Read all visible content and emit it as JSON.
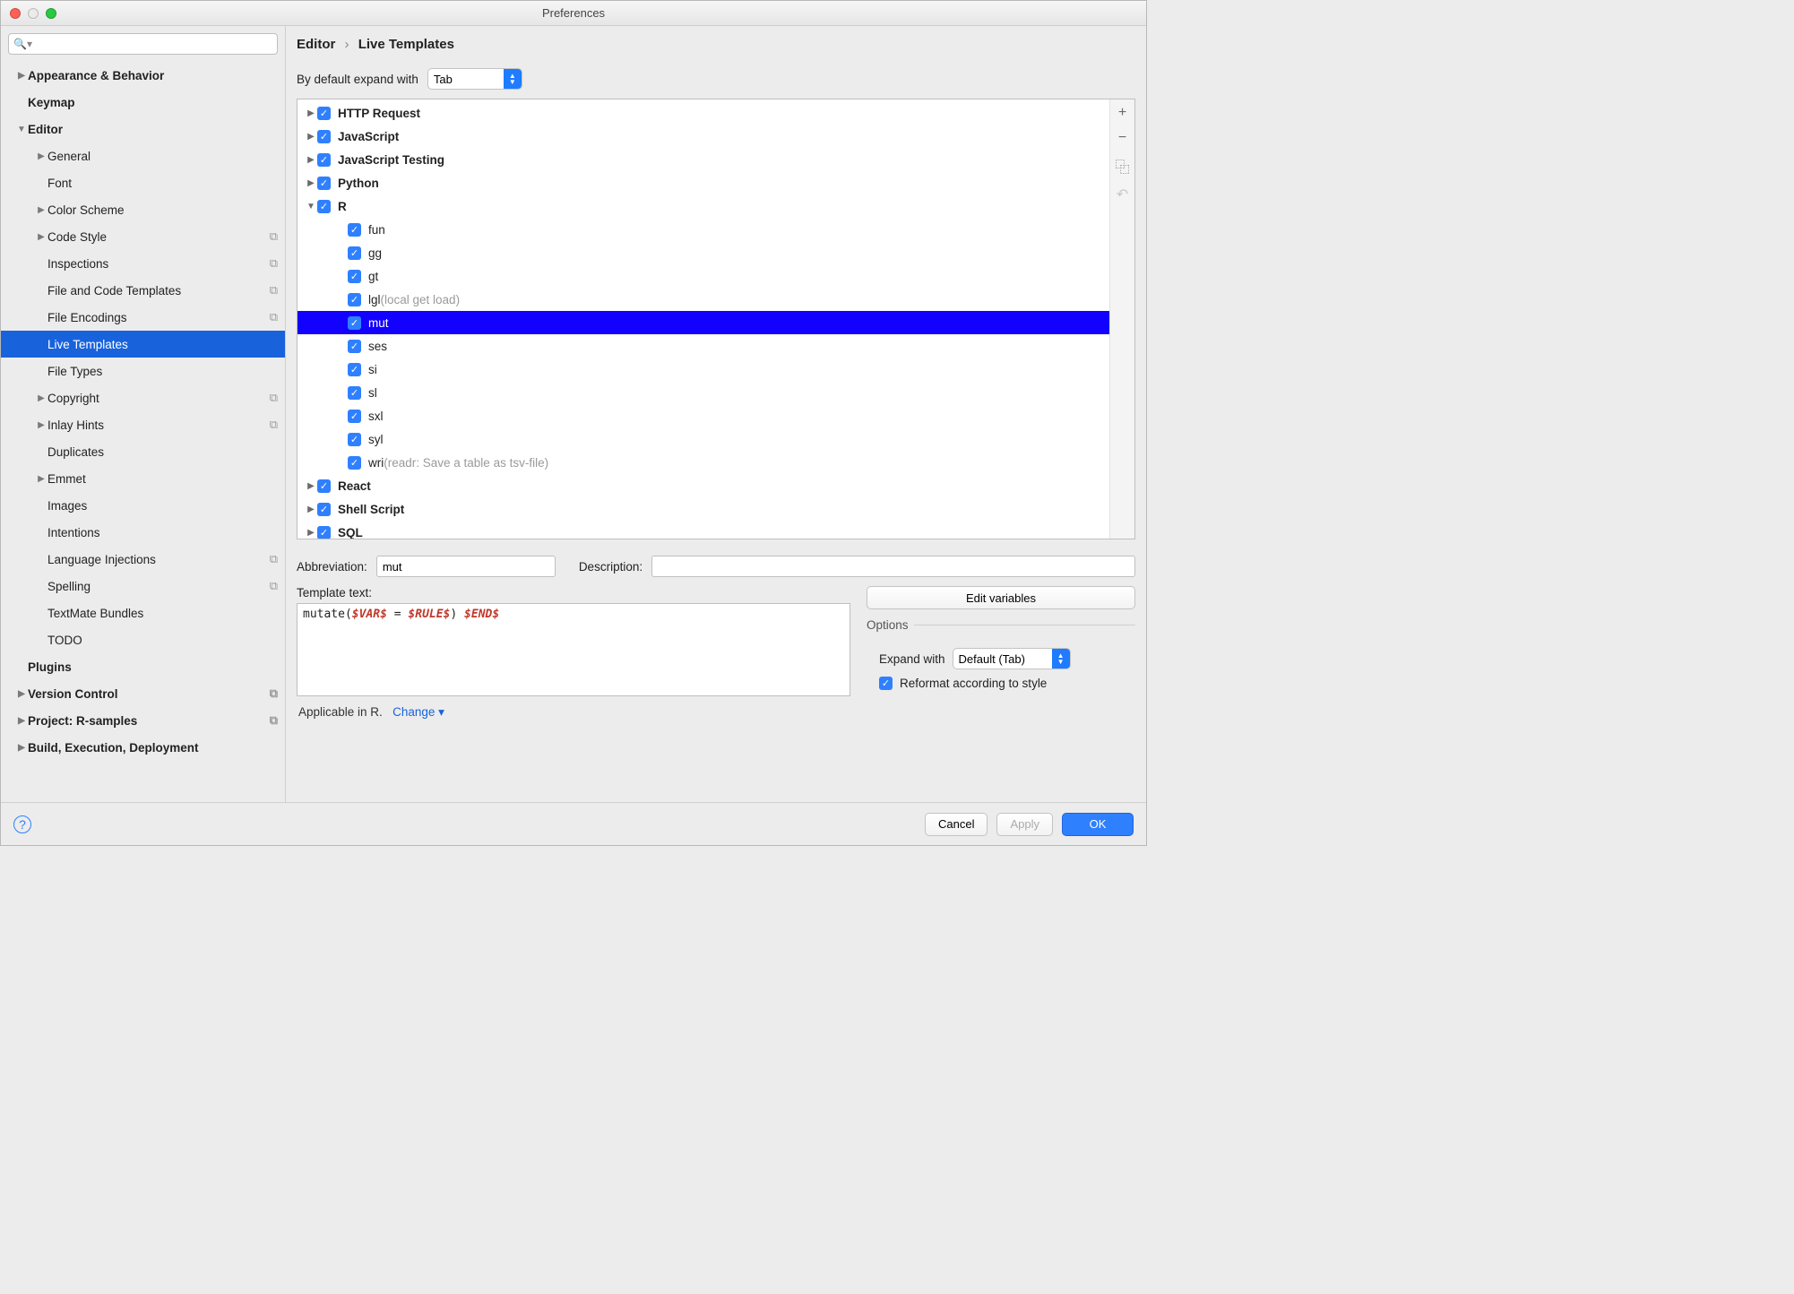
{
  "window_title": "Preferences",
  "search_placeholder": "",
  "breadcrumb": {
    "a": "Editor",
    "b": "Live Templates"
  },
  "expand_label": "By default expand with",
  "expand_value": "Tab",
  "sidebar": [
    {
      "label": "Appearance & Behavior",
      "bold": true,
      "indent": 0,
      "disc": "▶",
      "badge": ""
    },
    {
      "label": "Keymap",
      "bold": true,
      "indent": 0,
      "disc": "",
      "badge": ""
    },
    {
      "label": "Editor",
      "bold": true,
      "indent": 0,
      "disc": "▼",
      "badge": ""
    },
    {
      "label": "General",
      "bold": false,
      "indent": 1,
      "disc": "▶",
      "badge": ""
    },
    {
      "label": "Font",
      "bold": false,
      "indent": 1,
      "disc": "",
      "badge": ""
    },
    {
      "label": "Color Scheme",
      "bold": false,
      "indent": 1,
      "disc": "▶",
      "badge": ""
    },
    {
      "label": "Code Style",
      "bold": false,
      "indent": 1,
      "disc": "▶",
      "badge": "⧉"
    },
    {
      "label": "Inspections",
      "bold": false,
      "indent": 1,
      "disc": "",
      "badge": "⧉"
    },
    {
      "label": "File and Code Templates",
      "bold": false,
      "indent": 1,
      "disc": "",
      "badge": "⧉"
    },
    {
      "label": "File Encodings",
      "bold": false,
      "indent": 1,
      "disc": "",
      "badge": "⧉"
    },
    {
      "label": "Live Templates",
      "bold": false,
      "indent": 1,
      "disc": "",
      "badge": "",
      "selected": true
    },
    {
      "label": "File Types",
      "bold": false,
      "indent": 1,
      "disc": "",
      "badge": ""
    },
    {
      "label": "Copyright",
      "bold": false,
      "indent": 1,
      "disc": "▶",
      "badge": "⧉"
    },
    {
      "label": "Inlay Hints",
      "bold": false,
      "indent": 1,
      "disc": "▶",
      "badge": "⧉"
    },
    {
      "label": "Duplicates",
      "bold": false,
      "indent": 1,
      "disc": "",
      "badge": ""
    },
    {
      "label": "Emmet",
      "bold": false,
      "indent": 1,
      "disc": "▶",
      "badge": ""
    },
    {
      "label": "Images",
      "bold": false,
      "indent": 1,
      "disc": "",
      "badge": ""
    },
    {
      "label": "Intentions",
      "bold": false,
      "indent": 1,
      "disc": "",
      "badge": ""
    },
    {
      "label": "Language Injections",
      "bold": false,
      "indent": 1,
      "disc": "",
      "badge": "⧉"
    },
    {
      "label": "Spelling",
      "bold": false,
      "indent": 1,
      "disc": "",
      "badge": "⧉"
    },
    {
      "label": "TextMate Bundles",
      "bold": false,
      "indent": 1,
      "disc": "",
      "badge": ""
    },
    {
      "label": "TODO",
      "bold": false,
      "indent": 1,
      "disc": "",
      "badge": ""
    },
    {
      "label": "Plugins",
      "bold": true,
      "indent": 0,
      "disc": "",
      "badge": ""
    },
    {
      "label": "Version Control",
      "bold": true,
      "indent": 0,
      "disc": "▶",
      "badge": "⧉"
    },
    {
      "label": "Project: R-samples",
      "bold": true,
      "indent": 0,
      "disc": "▶",
      "badge": "⧉"
    },
    {
      "label": "Build, Execution, Deployment",
      "bold": true,
      "indent": 0,
      "disc": "▶",
      "badge": ""
    }
  ],
  "tree": [
    {
      "kind": "group",
      "label": "HTTP Request",
      "arrow": "▶"
    },
    {
      "kind": "group",
      "label": "JavaScript",
      "arrow": "▶"
    },
    {
      "kind": "group",
      "label": "JavaScript Testing",
      "arrow": "▶"
    },
    {
      "kind": "group",
      "label": "Python",
      "arrow": "▶"
    },
    {
      "kind": "group",
      "label": "R",
      "arrow": "▼"
    },
    {
      "kind": "child",
      "label": "fun",
      "hint": ""
    },
    {
      "kind": "child",
      "label": "gg",
      "hint": ""
    },
    {
      "kind": "child",
      "label": "gt",
      "hint": ""
    },
    {
      "kind": "child",
      "label": "lgl",
      "hint": "(local get load)"
    },
    {
      "kind": "child",
      "label": "mut",
      "hint": "",
      "selected": true
    },
    {
      "kind": "child",
      "label": "ses",
      "hint": ""
    },
    {
      "kind": "child",
      "label": "si",
      "hint": ""
    },
    {
      "kind": "child",
      "label": "sl",
      "hint": ""
    },
    {
      "kind": "child",
      "label": "sxl",
      "hint": ""
    },
    {
      "kind": "child",
      "label": "syl",
      "hint": ""
    },
    {
      "kind": "child",
      "label": "wri",
      "hint": "(readr: Save a table as tsv-file)"
    },
    {
      "kind": "group",
      "label": "React",
      "arrow": "▶"
    },
    {
      "kind": "group",
      "label": "Shell Script",
      "arrow": "▶"
    },
    {
      "kind": "group",
      "label": "SQL",
      "arrow": "▶"
    }
  ],
  "tools": {
    "add": "+",
    "remove": "−",
    "dup": "⿻",
    "undo": "↶"
  },
  "form": {
    "abbr_label": "Abbreviation:",
    "abbr_value": "mut",
    "desc_label": "Description:",
    "desc_value": "",
    "ttext_label": "Template text:",
    "ttext_prefix": "mutate(",
    "ttext_var1": "$VAR$",
    "ttext_eq": " = ",
    "ttext_var2": "$RULE$",
    "ttext_close": ") ",
    "ttext_var3": "$END$",
    "editvars": "Edit variables",
    "options_legend": "Options",
    "expandwith_label": "Expand with",
    "expandwith_value": "Default (Tab)",
    "reformat_label": "Reformat according to style",
    "applicable": "Applicable in R.",
    "change": "Change"
  },
  "footer": {
    "cancel": "Cancel",
    "apply": "Apply",
    "ok": "OK"
  }
}
